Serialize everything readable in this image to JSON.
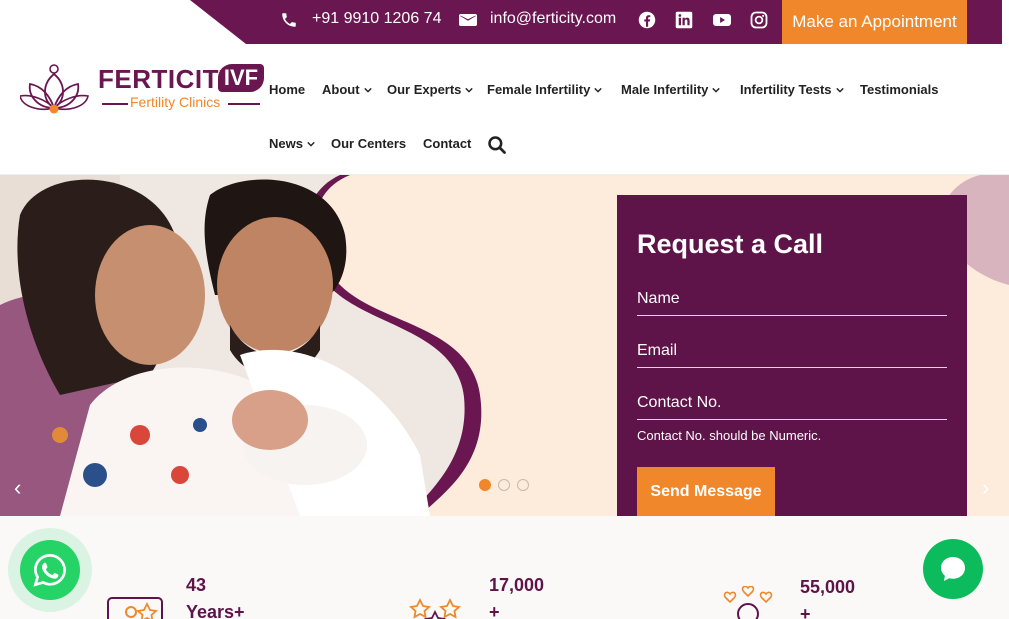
{
  "topbar": {
    "phone": "+91 9910 1206 74",
    "email": "info@ferticity.com",
    "social": [
      "facebook-icon",
      "linkedin-icon",
      "youtube-icon",
      "instagram-icon"
    ],
    "appointment_label": "Make an Appointment"
  },
  "logo": {
    "name": "FERTICITY",
    "badge": "IVF",
    "tagline": "Fertility Clinics"
  },
  "nav": {
    "home": "Home",
    "about": "About",
    "experts": "Our Experts",
    "female": "Female Infertility",
    "male": "Male Infertility",
    "tests": "Infertility Tests",
    "testimonials": "Testimonials",
    "news": "News",
    "centers": "Our Centers",
    "contact": "Contact"
  },
  "hero": {
    "prev_arrow": "‹",
    "next_arrow": "›",
    "slides": 3,
    "active_slide": 1
  },
  "form": {
    "title": "Request a Call",
    "name_placeholder": "Name",
    "email_placeholder": "Email",
    "contact_placeholder": "Contact No.",
    "note": "Contact No. should be Numeric.",
    "submit": "Send Message"
  },
  "stats": [
    {
      "number": "43",
      "suffix": "Years+"
    },
    {
      "number": "17,000",
      "suffix": "+"
    },
    {
      "number": "55,000",
      "suffix": "+"
    }
  ],
  "colors": {
    "brand": "#6a1650",
    "accent": "#f0872a",
    "whatsapp": "#25d366"
  }
}
